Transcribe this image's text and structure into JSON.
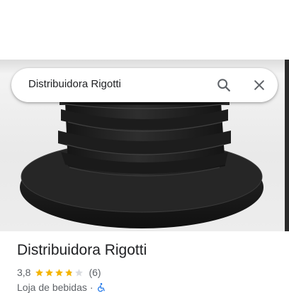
{
  "search": {
    "query": "Distribuidora Rigotti",
    "search_icon": "search-icon",
    "close_icon": "close-icon"
  },
  "place": {
    "name": "Distribuidora Rigotti",
    "rating": "3,8",
    "rating_value": 3.8,
    "rating_max": 5,
    "review_count": "(6)",
    "category": "Loja de bebidas",
    "separator": "·",
    "accessibility_icon": "wheelchair-accessible-icon"
  },
  "colors": {
    "star_filled": "#f4b400",
    "star_empty": "#dadce0",
    "accessibility_blue": "#1a73e8",
    "text_primary": "#202124",
    "text_secondary": "#5f6368"
  }
}
